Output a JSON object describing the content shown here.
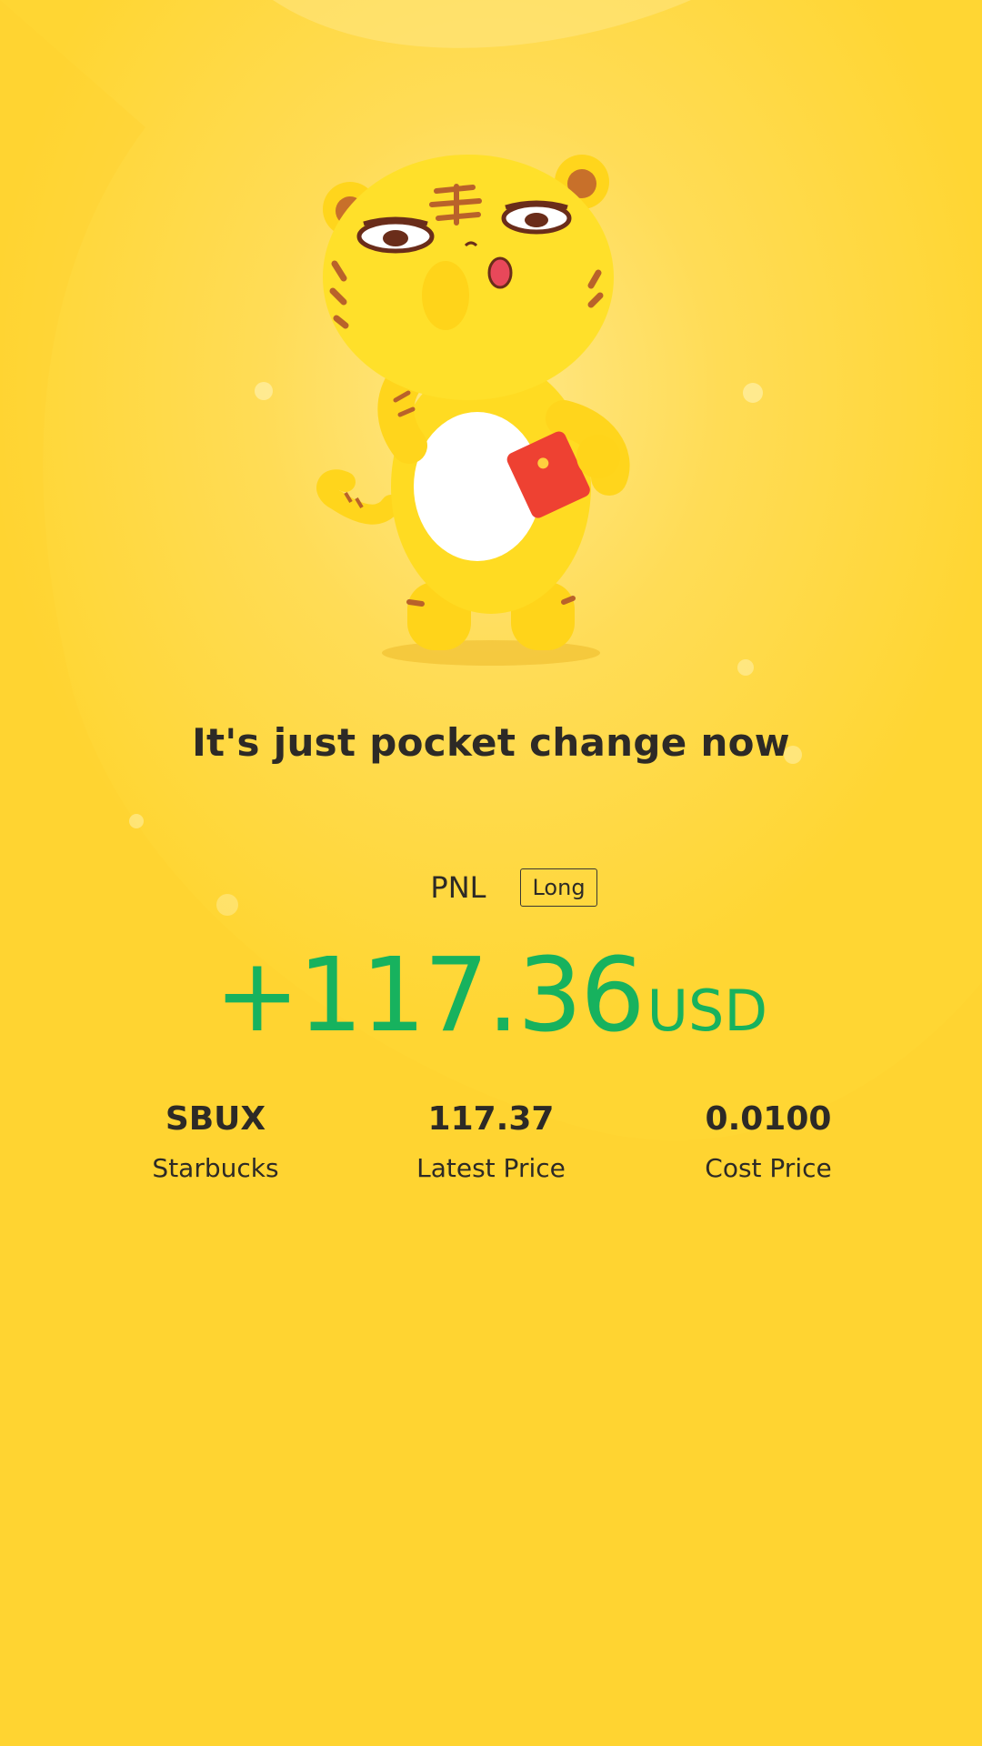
{
  "headline": "It's just pocket change now",
  "pnl": {
    "label": "PNL",
    "direction": "Long",
    "amount": "+117.36",
    "currency": "USD"
  },
  "stats": [
    {
      "value": "SBUX",
      "label": "Starbucks"
    },
    {
      "value": "117.37",
      "label": "Latest Price"
    },
    {
      "value": "0.0100",
      "label": "Cost Price"
    }
  ],
  "mascot": {
    "icon": "tiger-mascot-icon",
    "holding": "red-envelope"
  },
  "colors": {
    "background": "#ffd633",
    "profit": "#17b25e",
    "text": "#2d2a26"
  }
}
